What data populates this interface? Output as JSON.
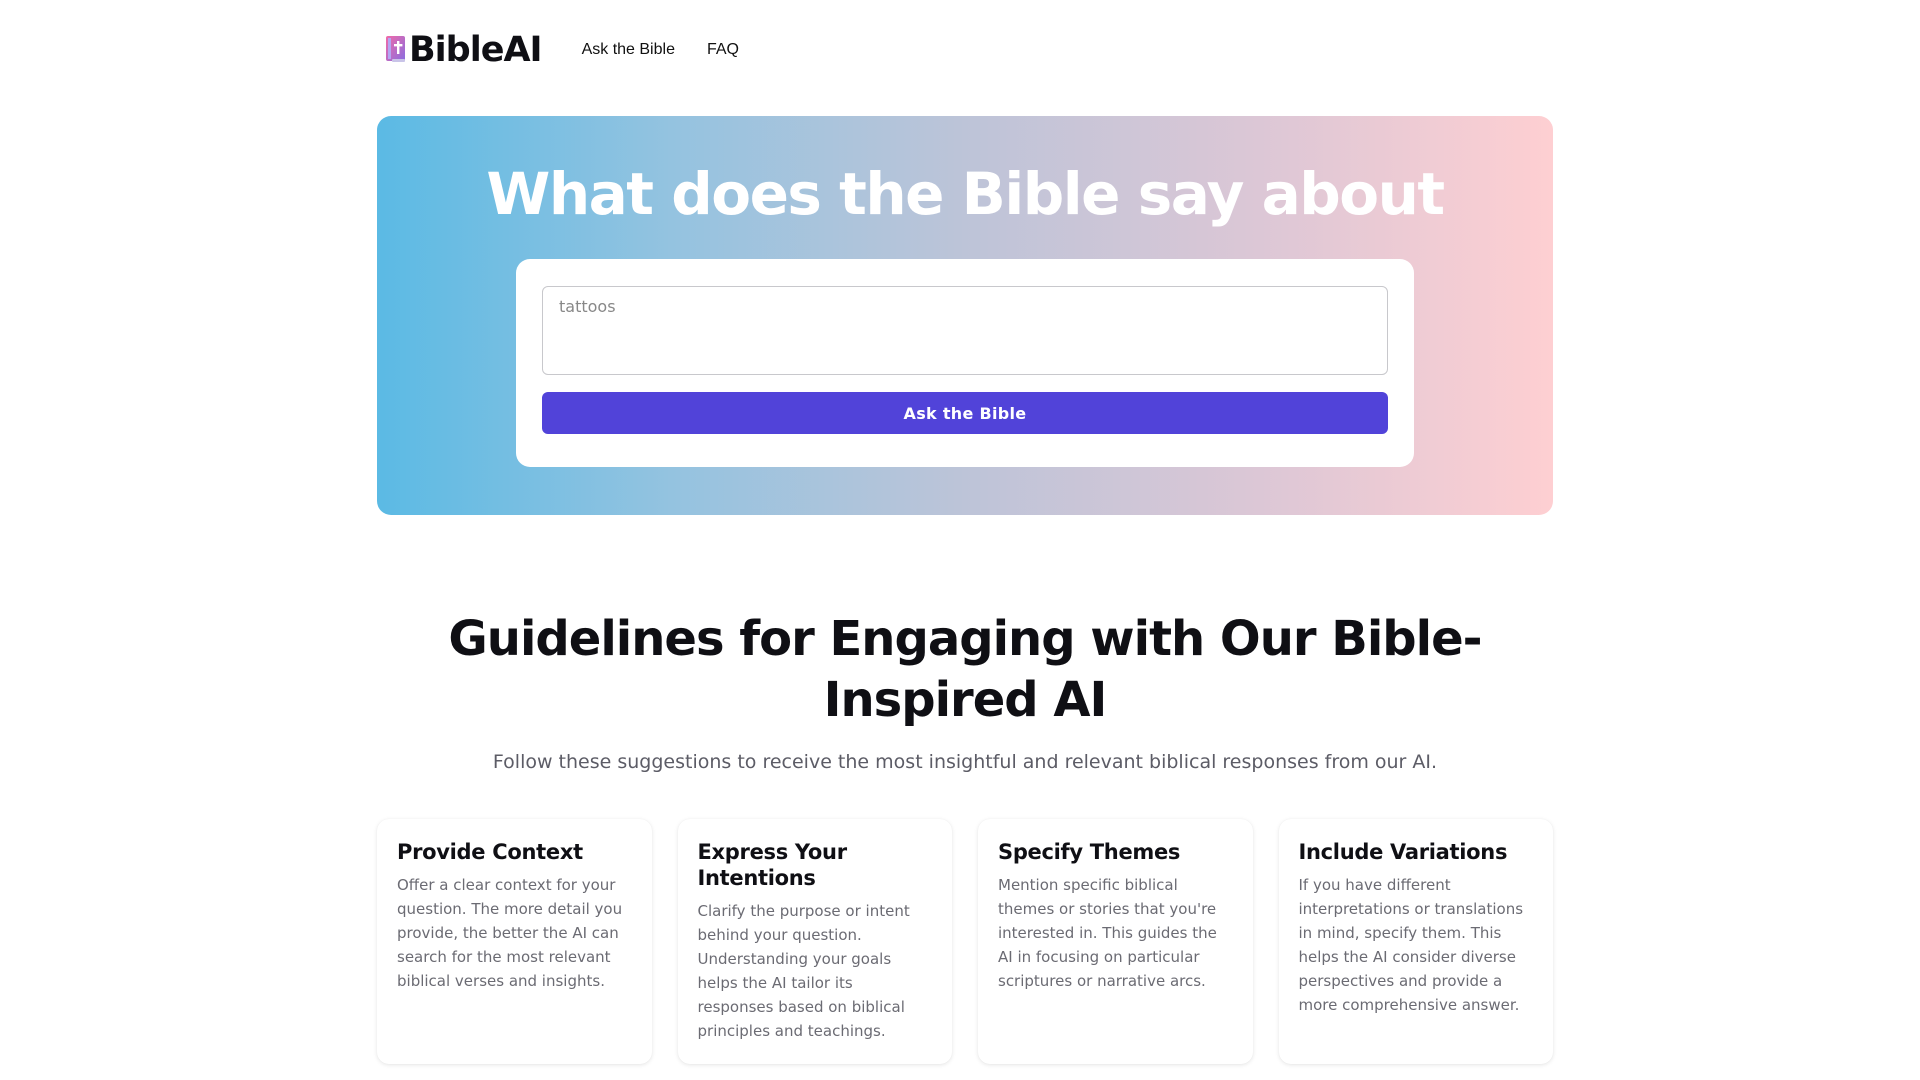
{
  "header": {
    "logo_text": "BibleAI",
    "nav": [
      {
        "label": "Ask the Bible"
      },
      {
        "label": "FAQ"
      }
    ]
  },
  "hero": {
    "title": "What does the Bible say about",
    "input_placeholder": "tattoos",
    "button_label": "Ask the Bible"
  },
  "guidelines": {
    "title": "Guidelines for Engaging with Our Bible-Inspired AI",
    "subtitle": "Follow these suggestions to receive the most insightful and relevant biblical responses from our AI.",
    "cards": [
      {
        "title": "Provide Context",
        "body": "Offer a clear context for your question. The more detail you provide, the better the AI can search for the most relevant biblical verses and insights."
      },
      {
        "title": "Express Your Intentions",
        "body": "Clarify the purpose or intent behind your question. Understanding your goals helps the AI tailor its responses based on biblical principles and teachings."
      },
      {
        "title": "Specify Themes",
        "body": "Mention specific biblical themes or stories that you're interested in. This guides the AI in focusing on particular scriptures or narrative arcs."
      },
      {
        "title": "Include Variations",
        "body": "If you have different interpretations or translations in mind, specify them. This helps the AI consider diverse perspectives and provide a more comprehensive answer."
      }
    ]
  },
  "colors": {
    "accent": "#5143d9",
    "gradient_start": "#5bbae4",
    "gradient_end": "#fecfd2"
  },
  "icons": {
    "logo": "bible-book-icon"
  }
}
